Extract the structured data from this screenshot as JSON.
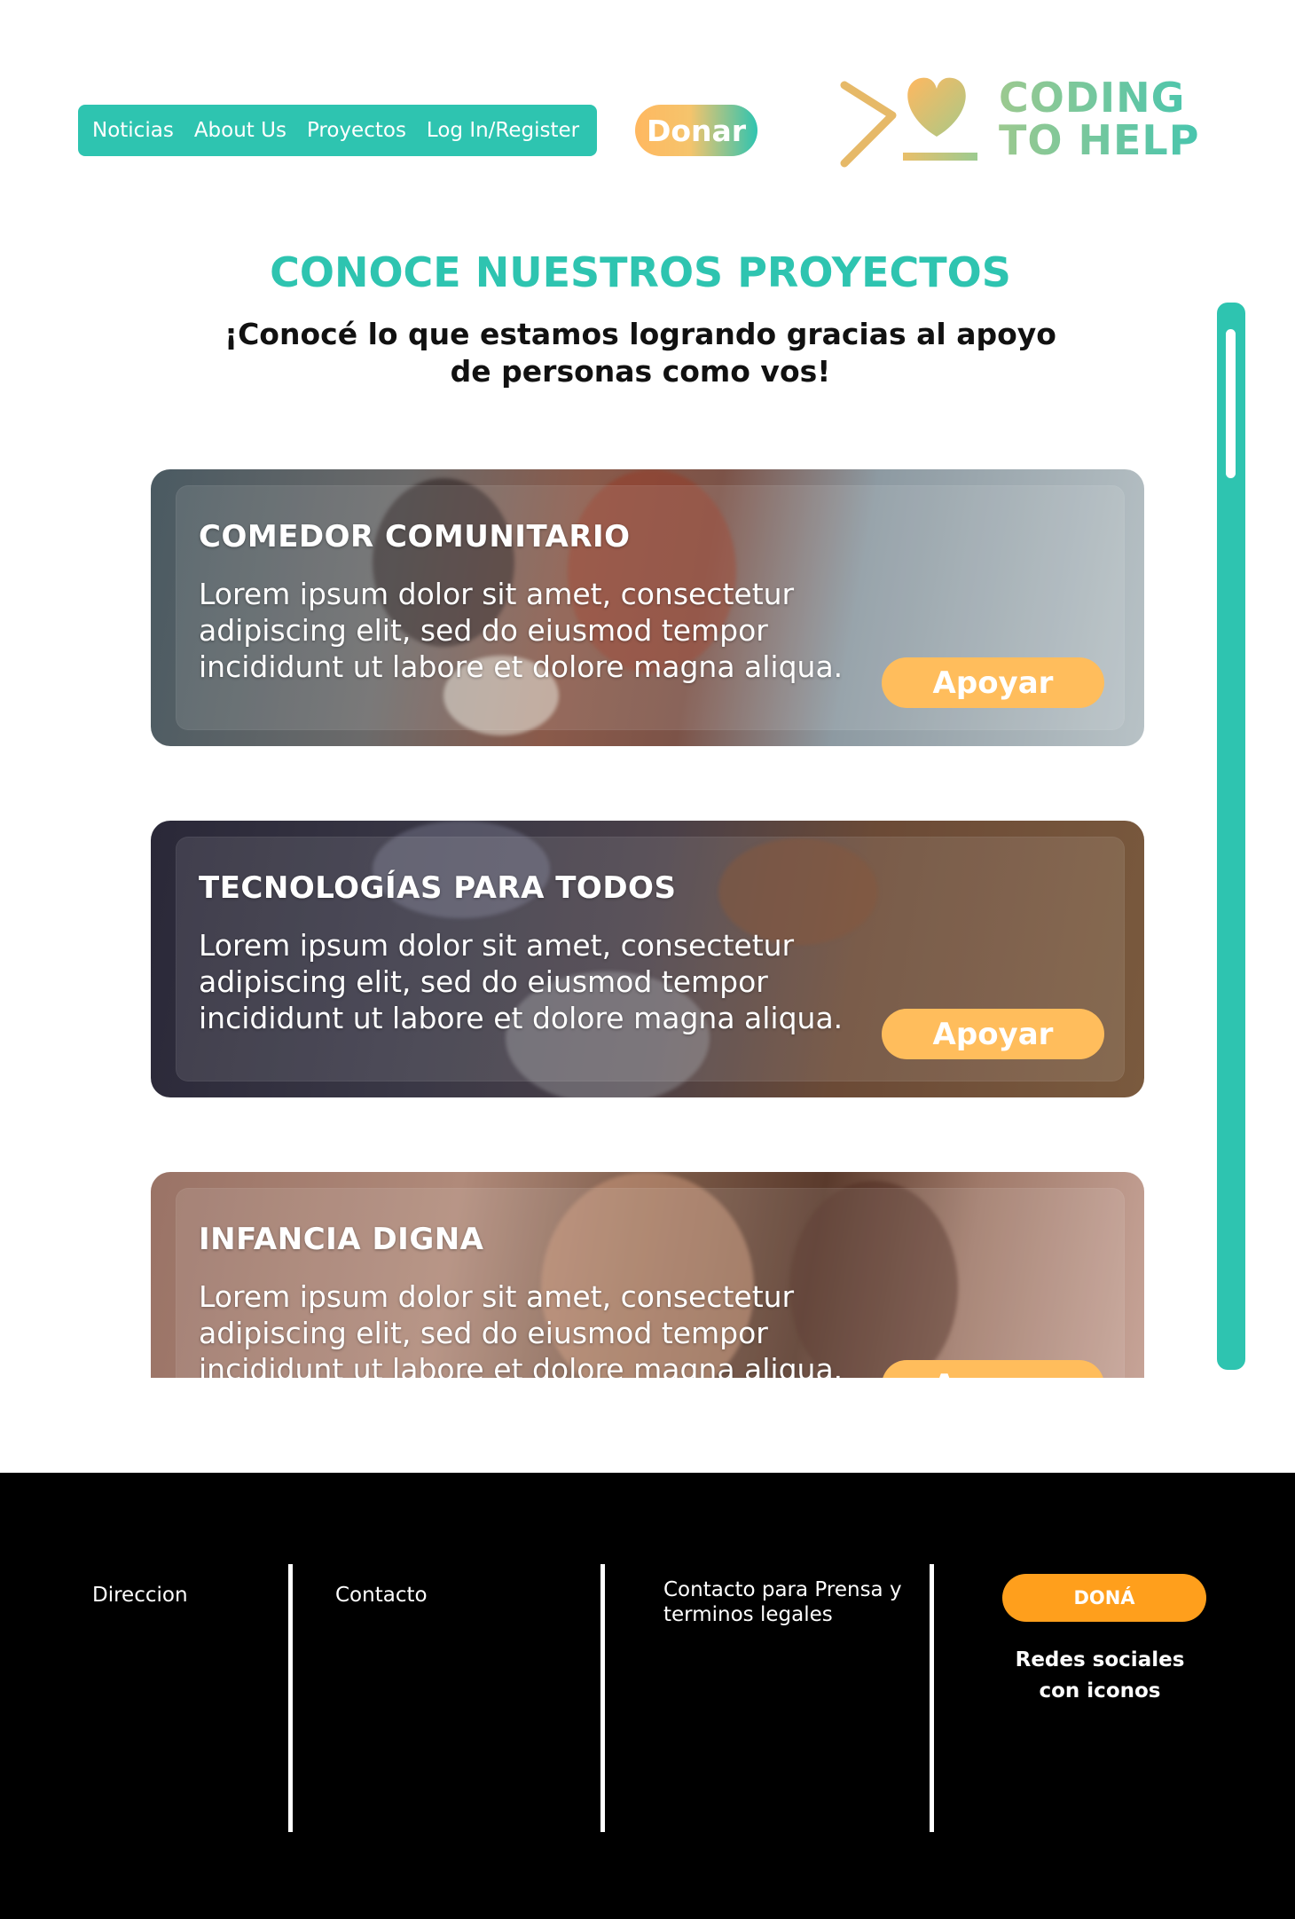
{
  "header": {
    "nav": [
      "Noticias",
      "About Us",
      "Proyectos",
      "Log In/Register"
    ],
    "donate_label": "Donar",
    "logo_line1": "CODING",
    "logo_line2": "TO HELP"
  },
  "intro": {
    "title": "CONOCE NUESTROS PROYECTOS",
    "subtitle": "¡Conocé lo que estamos logrando gracias al apoyo de personas como vos!"
  },
  "projects": [
    {
      "title": "COMEDOR COMUNITARIO",
      "text": "Lorem ipsum dolor sit amet, consectetur adipiscing elit, sed do eiusmod tempor incididunt ut labore et dolore magna aliqua.",
      "button": "Apoyar"
    },
    {
      "title": "TECNOLOGÍAS PARA TODOS",
      "text": "Lorem ipsum dolor sit amet, consectetur adipiscing elit, sed do eiusmod tempor incididunt ut labore et dolore magna aliqua.",
      "button": "Apoyar"
    },
    {
      "title": "INFANCIA DIGNA",
      "text": "Lorem ipsum dolor sit amet, consectetur adipiscing elit, sed do eiusmod tempor incididunt ut labore et dolore magna aliqua.",
      "button": "Apoyar"
    }
  ],
  "footer": {
    "direccion": "Direccion",
    "contacto": "Contacto",
    "prensa": "Contacto para Prensa y terminos legales",
    "dona_label": "DONÁ",
    "redes": "Redes sociales con iconos"
  },
  "colors": {
    "teal": "#2ec4b0",
    "orange": "#ffbd5c",
    "footer_orange": "#ff9f1c",
    "footer_bg": "#000000"
  }
}
